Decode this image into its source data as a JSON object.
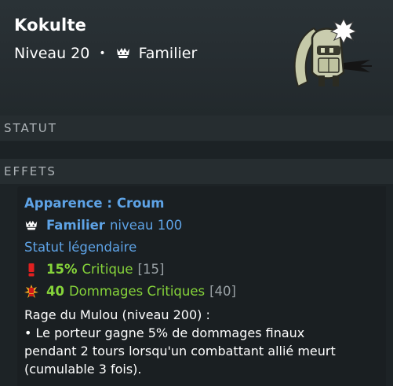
{
  "header": {
    "name": "Kokulte",
    "level": "Niveau 20",
    "separator": "•",
    "type": "Familier"
  },
  "sections": {
    "status": "STATUT",
    "effects": "EFFETS"
  },
  "effects": {
    "appearance_label": "Apparence :",
    "appearance_value": "Croum",
    "pet_type": "Familier",
    "pet_level": "niveau 100",
    "legendary": "Statut légendaire",
    "crit_value": "15%",
    "crit_label": "Critique",
    "crit_points": "[15]",
    "critdmg_value": "40",
    "critdmg_label": "Dommages Critiques",
    "critdmg_points": "[40]",
    "rage_title": "Rage du Mulou (niveau 200) :",
    "rage_line1": "• Le porteur gagne 5% de dommages finaux",
    "rage_line2": "pendant 2 tours lorsqu'un combattant allié meurt",
    "rage_line3": "(cumulable 3 fois)."
  },
  "icons": {
    "pet": "pet-crown-icon",
    "crit": "exclamation-icon",
    "critdmg": "explosion-icon",
    "portrait": "kokulte-pet-portrait"
  },
  "colors": {
    "blue": "#5ea3e6",
    "green": "#86d43a",
    "grey": "#9aa2a6",
    "crit_red": "#e02020"
  }
}
